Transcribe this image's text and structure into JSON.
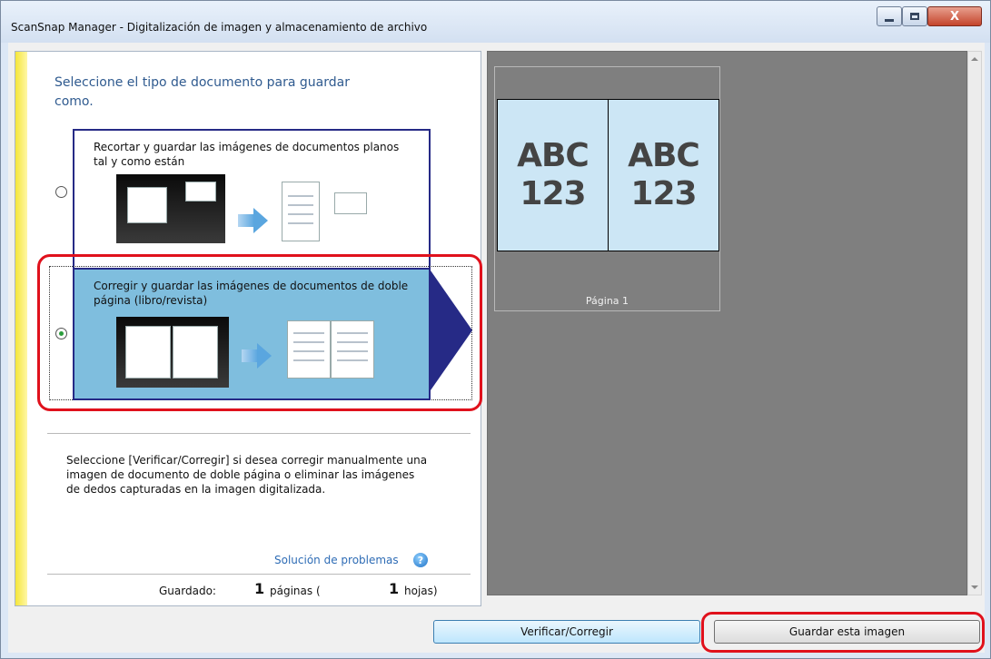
{
  "window": {
    "title": "ScanSnap Manager - Digitalización de imagen y almacenamiento de archivo",
    "close_glyph": "X"
  },
  "left_pane": {
    "prompt": "Seleccione el tipo de documento para guardar como.",
    "options": [
      {
        "label": "Recortar y guardar las imágenes de documentos planos tal y como están",
        "selected": false
      },
      {
        "label": "Corregir y guardar las imágenes de documentos de doble página (libro/revista)",
        "selected": true
      }
    ],
    "hint": "Seleccione [Verificar/Corregir] si desea corregir manualmente una imagen de documento de doble página o eliminar las imágenes de dedos capturadas en la imagen digitalizada.",
    "troubleshooting_link": "Solución de problemas",
    "help_glyph": "?",
    "status": {
      "saved_label": "Guardado:",
      "pages_count": "1",
      "pages_label": "páginas (",
      "sheets_count": "1",
      "sheets_label": "hojas)"
    }
  },
  "preview": {
    "page_left_text": [
      "ABC",
      "123"
    ],
    "page_right_text": [
      "ABC",
      "123"
    ],
    "caption": "Página 1"
  },
  "buttons": {
    "verify": "Verificar/Corregir",
    "save": "Guardar esta imagen"
  },
  "colors": {
    "accent_red": "#e0111c",
    "option_border": "#262a86",
    "selected_fill": "#7fbede",
    "preview_bg": "#7f7f7f",
    "thumb_fill": "#cce6f5"
  }
}
